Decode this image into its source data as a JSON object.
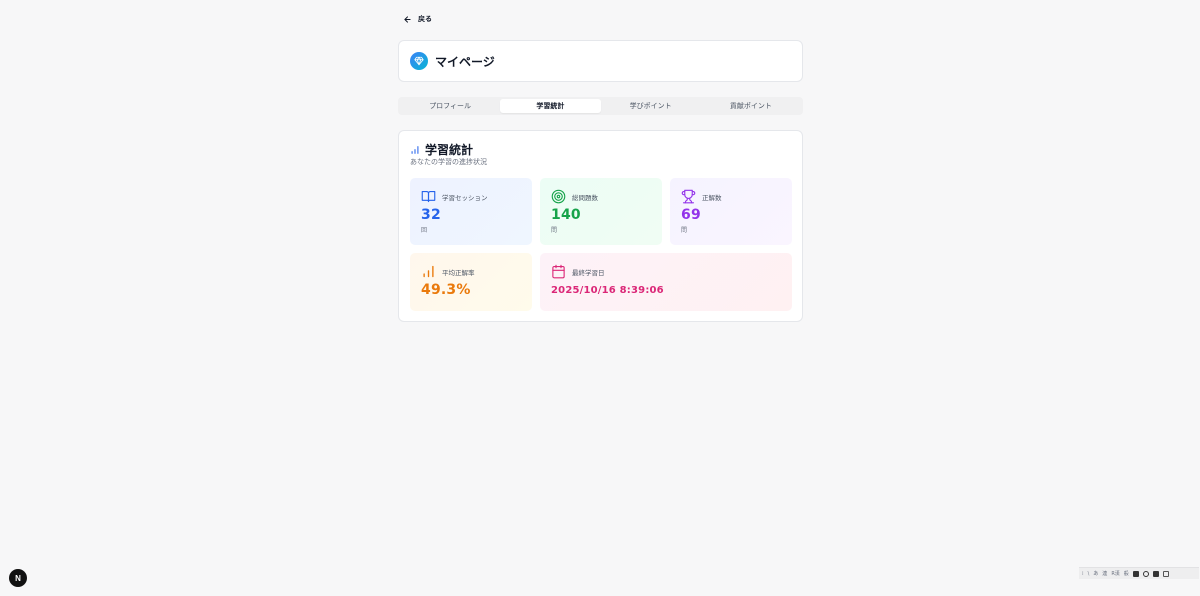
{
  "nav": {
    "back_label": "戻る"
  },
  "header": {
    "title": "マイページ",
    "icon": "gem-icon"
  },
  "tabs": [
    {
      "label": "プロフィール",
      "active": false
    },
    {
      "label": "学習統計",
      "active": true
    },
    {
      "label": "学びポイント",
      "active": false
    },
    {
      "label": "貢献ポイント",
      "active": false
    }
  ],
  "stats": {
    "title": "学習統計",
    "subtitle": "あなたの学習の進捗状況",
    "sessions": {
      "label": "学習セッション",
      "value": "32",
      "unit": "回",
      "icon": "book-icon",
      "color": "#2563eb"
    },
    "total_questions": {
      "label": "総問題数",
      "value": "140",
      "unit": "問",
      "icon": "target-icon",
      "color": "#16a34a"
    },
    "correct": {
      "label": "正解数",
      "value": "69",
      "unit": "問",
      "icon": "trophy-icon",
      "color": "#9333ea"
    },
    "accuracy": {
      "label": "平均正解率",
      "value": "49.3%",
      "icon": "bar-chart-icon",
      "color": "#ea7a0c"
    },
    "last_study": {
      "label": "最終学習日",
      "value": "2025/10/16 8:39:06",
      "icon": "calendar-icon",
      "color": "#db2777"
    }
  },
  "devtools": {
    "badge": "N"
  },
  "tray": {
    "items": [
      "あ",
      "連",
      "R漢",
      "般"
    ]
  }
}
